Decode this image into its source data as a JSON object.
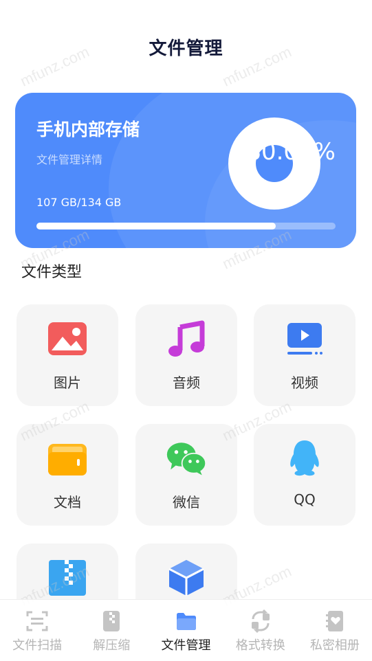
{
  "header": {
    "title": "文件管理"
  },
  "storage": {
    "title": "手机内部存储",
    "subtitle": "文件管理详情",
    "used_text": "107 GB/134 GB",
    "percent_label": "80.00%",
    "progress": 0.8,
    "accent_color": "#4f8bfb"
  },
  "file_types": {
    "title": "文件类型",
    "items": [
      {
        "label": "图片",
        "icon": "image-icon"
      },
      {
        "label": "音频",
        "icon": "music-icon"
      },
      {
        "label": "视频",
        "icon": "video-icon"
      },
      {
        "label": "文档",
        "icon": "folder-icon"
      },
      {
        "label": "微信",
        "icon": "wechat-icon"
      },
      {
        "label": "QQ",
        "icon": "qq-icon"
      },
      {
        "label": "",
        "icon": "zip-icon"
      },
      {
        "label": "",
        "icon": "cube-icon"
      }
    ]
  },
  "watermark": "mfunz.com",
  "tabbar": {
    "items": [
      {
        "label": "文件扫描",
        "icon": "scan-icon",
        "active": false
      },
      {
        "label": "解压缩",
        "icon": "zip-file-icon",
        "active": false
      },
      {
        "label": "文件管理",
        "icon": "folder-icon",
        "active": true
      },
      {
        "label": "格式转换",
        "icon": "convert-icon",
        "active": false
      },
      {
        "label": "私密相册",
        "icon": "album-icon",
        "active": false
      }
    ]
  }
}
